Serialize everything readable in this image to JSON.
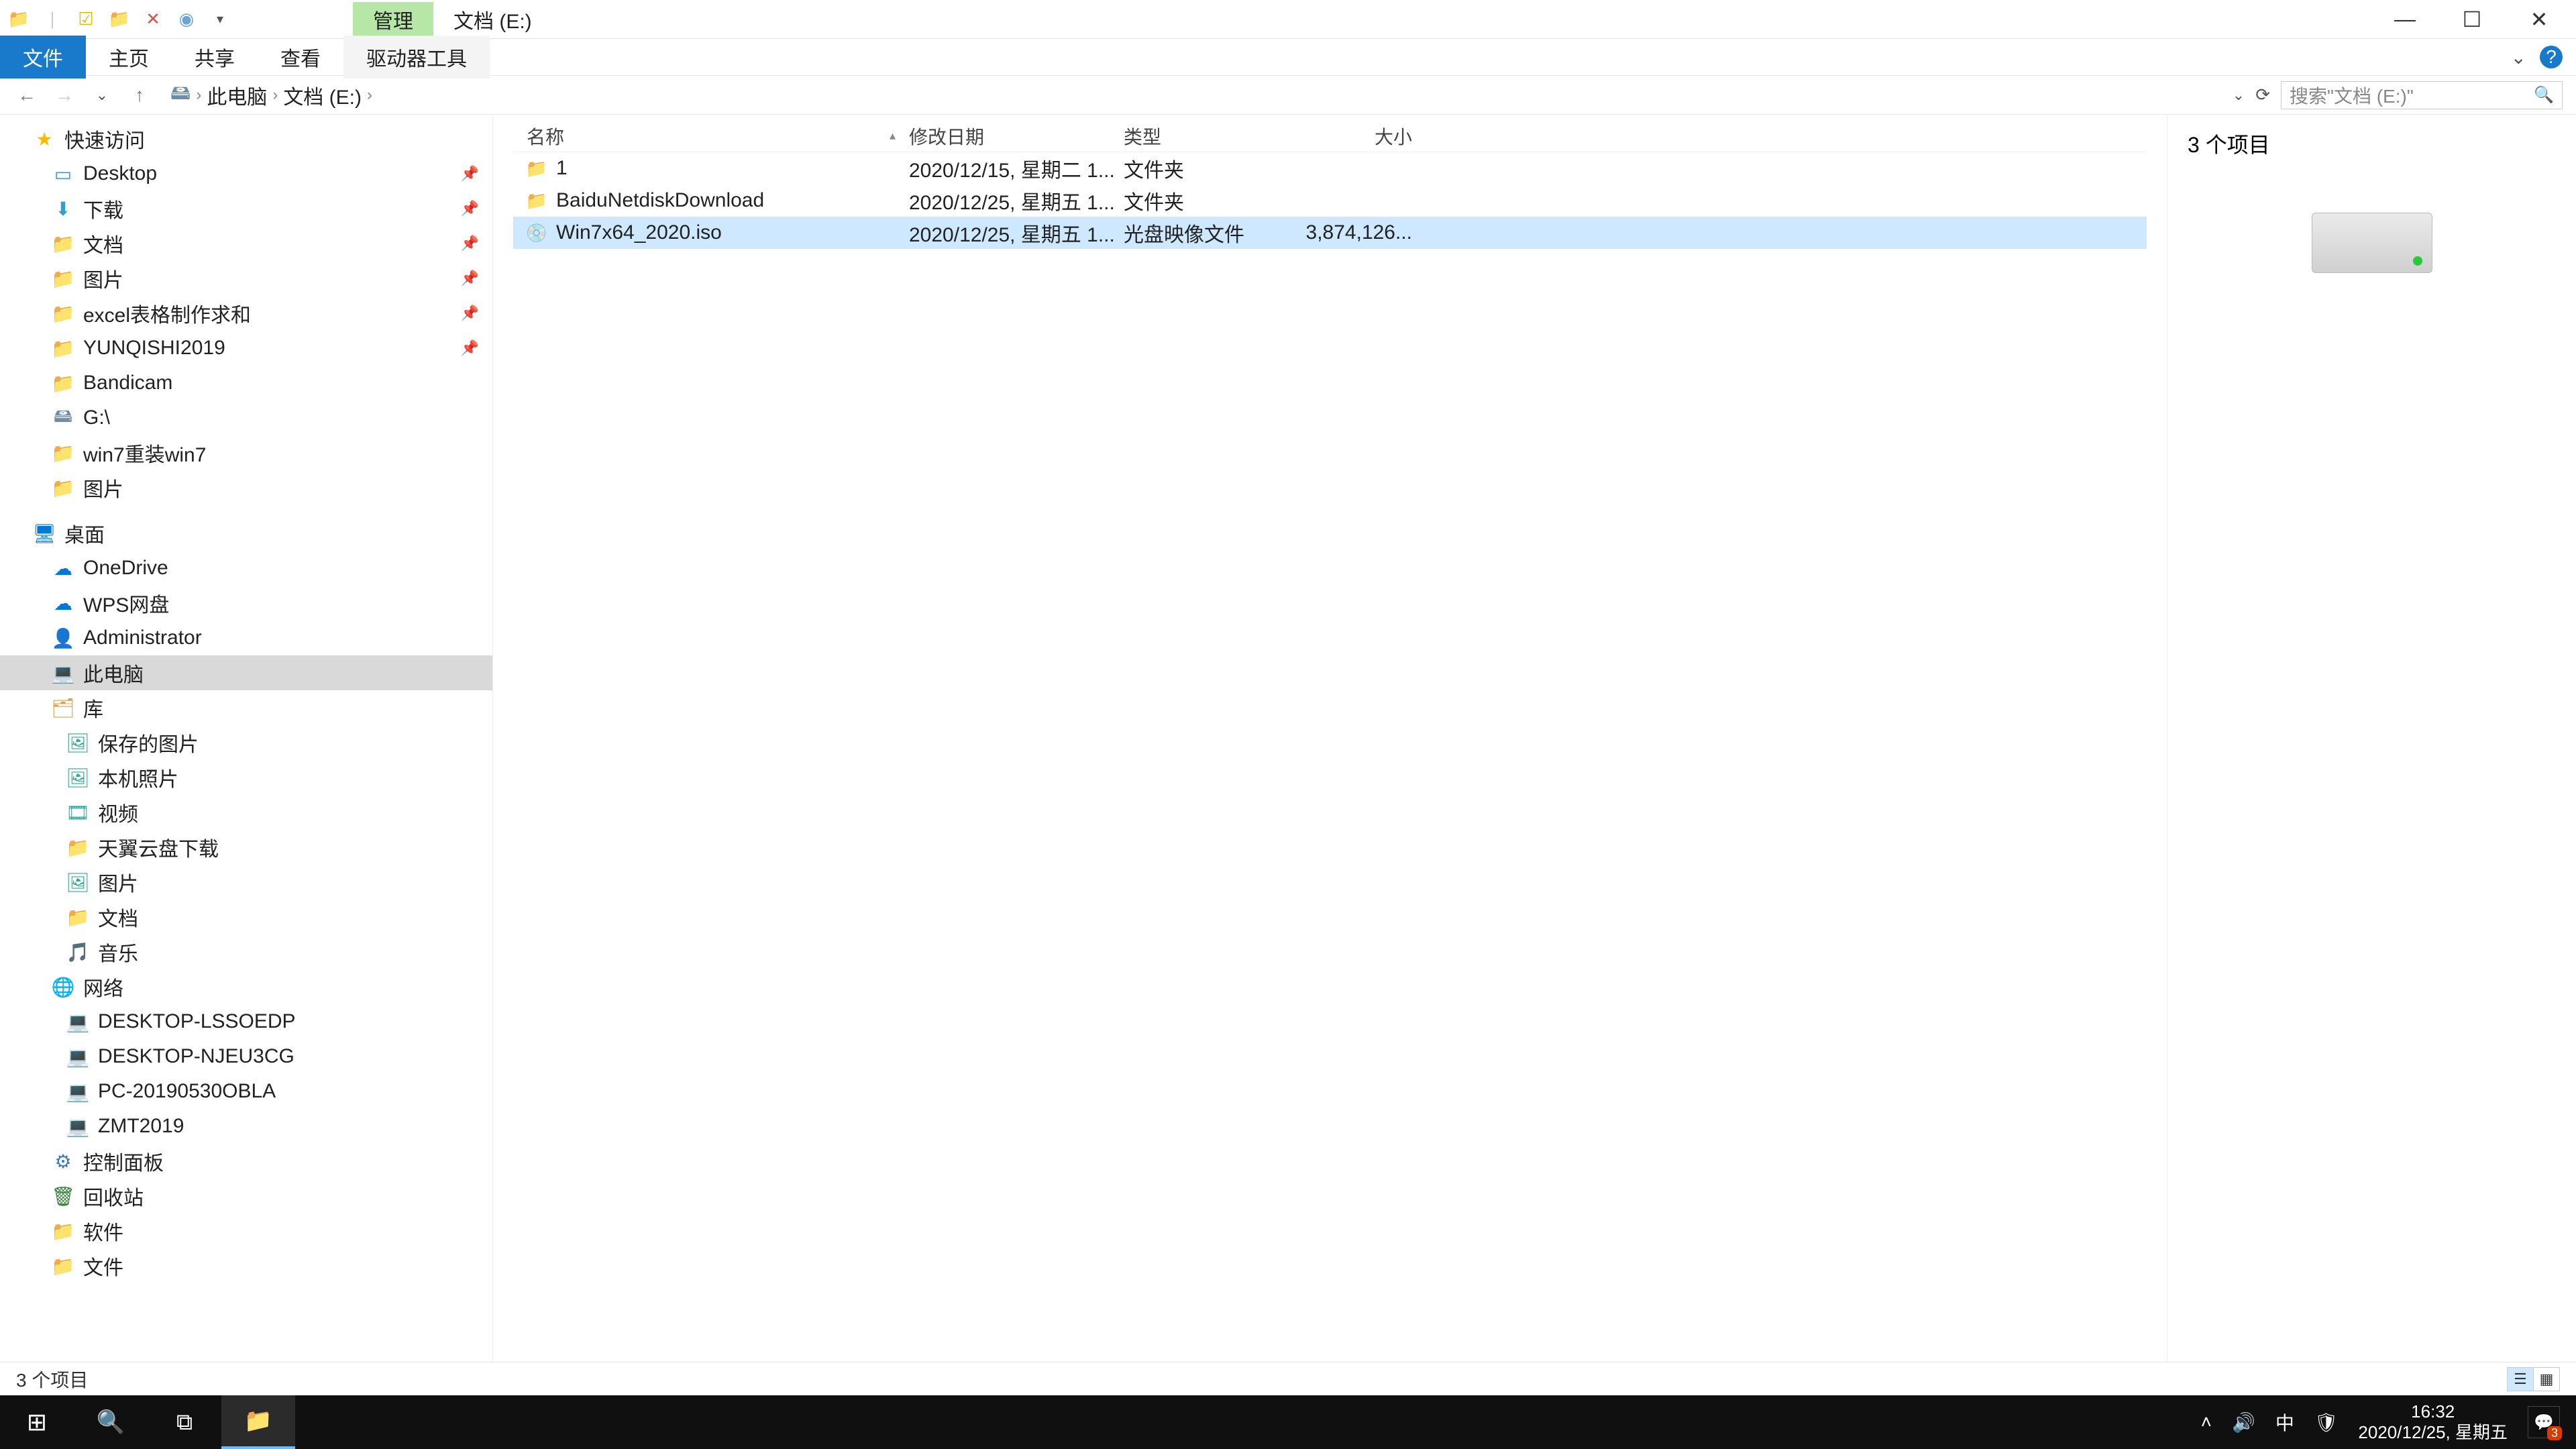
{
  "title_bar": {
    "ribbon_context": "管理",
    "window_title": "文档 (E:)"
  },
  "ribbon": {
    "file": "文件",
    "home": "主页",
    "share": "共享",
    "view": "查看",
    "drive_tools": "驱动器工具"
  },
  "address": {
    "crumb1": "此电脑",
    "crumb2": "文档 (E:)"
  },
  "search": {
    "placeholder": "搜索\"文档 (E:)\""
  },
  "nav": {
    "quick_access": "快速访问",
    "desktop": "Desktop",
    "downloads": "下载",
    "documents": "文档",
    "pictures": "图片",
    "excel": "excel表格制作求和",
    "yunqishi": "YUNQISHI2019",
    "bandicam": "Bandicam",
    "gdrive": "G:\\",
    "win7reload": "win7重装win7",
    "pictures2": "图片",
    "desktop_cn": "桌面",
    "onedrive": "OneDrive",
    "wps": "WPS网盘",
    "admin": "Administrator",
    "thispc": "此电脑",
    "library": "库",
    "saved_pics": "保存的图片",
    "camera": "本机照片",
    "videos": "视频",
    "tianyi": "天翼云盘下载",
    "pics_lib": "图片",
    "doc_lib": "文档",
    "music_lib": "音乐",
    "network": "网络",
    "pc1": "DESKTOP-LSSOEDP",
    "pc2": "DESKTOP-NJEU3CG",
    "pc3": "PC-20190530OBLA",
    "pc4": "ZMT2019",
    "control_panel": "控制面板",
    "recycle": "回收站",
    "software": "软件",
    "files_folder": "文件"
  },
  "columns": {
    "name": "名称",
    "date": "修改日期",
    "type": "类型",
    "size": "大小"
  },
  "rows": [
    {
      "name": "1",
      "date": "2020/12/15, 星期二 1...",
      "type": "文件夹",
      "size": "",
      "icon": "folder",
      "selected": false
    },
    {
      "name": "BaiduNetdiskDownload",
      "date": "2020/12/25, 星期五 1...",
      "type": "文件夹",
      "size": "",
      "icon": "folder",
      "selected": false
    },
    {
      "name": "Win7x64_2020.iso",
      "date": "2020/12/25, 星期五 1...",
      "type": "光盘映像文件",
      "size": "3,874,126...",
      "icon": "disc",
      "selected": true
    }
  ],
  "details": {
    "count_label": "3 个项目"
  },
  "status": {
    "item_count": "3 个项目"
  },
  "taskbar": {
    "time": "16:32",
    "date": "2020/12/25, 星期五",
    "ime": "中",
    "notif_count": "3"
  }
}
